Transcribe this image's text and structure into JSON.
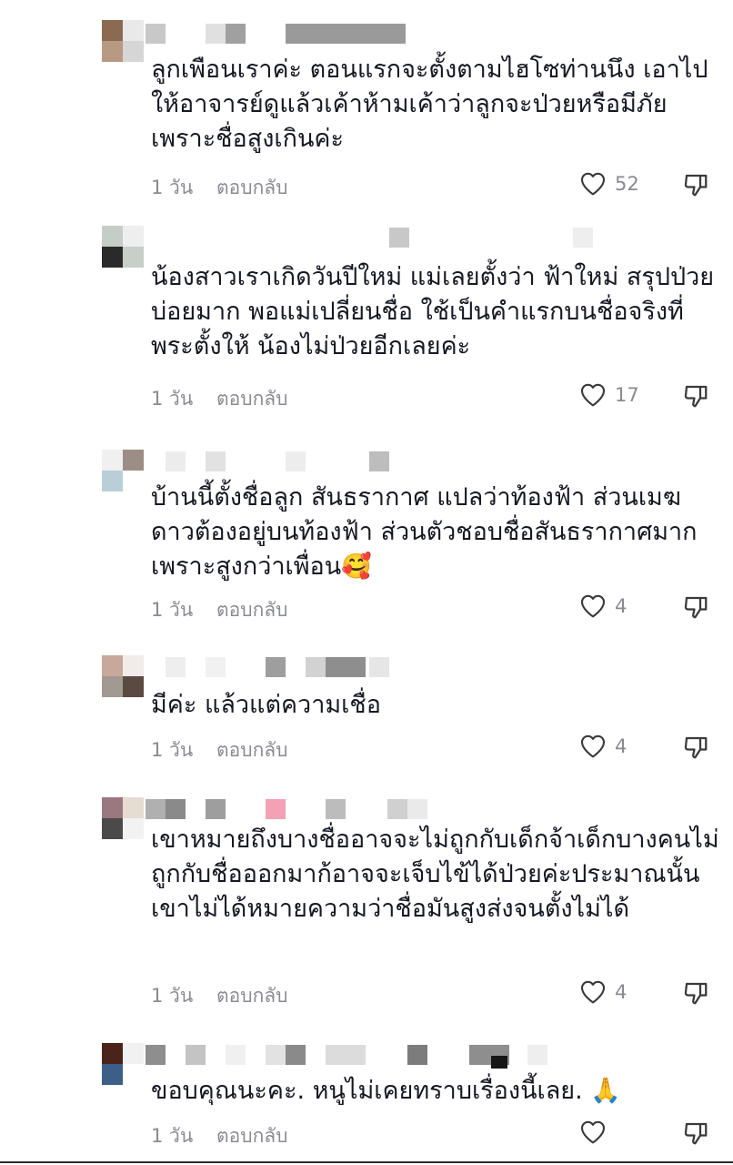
{
  "comments": [
    {
      "text": "ลูกเพือนเราค่ะ ตอนแรกจะตั้งตามไฮโซท่านนึง เอาไปให้อาจารย์ดูแล้วเค้าห้ามเค้าว่าลูกจะป่วยหรือมีภัยเพราะชื่อสูงเกินค่ะ",
      "time": "1 วัน",
      "reply": "ตอบกลับ",
      "likes": "52"
    },
    {
      "text": "น้องสาวเราเกิดวันปีใหม่ แม่เลยตั้งว่า ฟ้าใหม่ สรุปป่วยบ่อยมาก พอแม่เปลี่ยนชื่อ ใช้เป็นคำแรกบนชื่อจริงที่พระตั้งให้ น้องไม่ป่วยอีกเลยค่ะ",
      "time": "1 วัน",
      "reply": "ตอบกลับ",
      "likes": "17"
    },
    {
      "text": "บ้านนี้ตั้งชื่อลูก สันธรากาศ แปลว่าท้องฟ้า ส่วนเมฆดาวต้องอยู่บนท้องฟ้า ส่วนตัวชอบชื่อสันธรากาศมากเพราะสูงกว่าเพื่อน🥰",
      "time": "1 วัน",
      "reply": "ตอบกลับ",
      "likes": "4"
    },
    {
      "text": "มีค่ะ แล้วแต่ความเชื่อ",
      "time": "1 วัน",
      "reply": "ตอบกลับ",
      "likes": "4"
    },
    {
      "text": "เขาหมายถึงบางชื่ออาจจะไม่ถูกกับเด็กจ้าเด็กบางคนไม่ถูกกับชื่อออกมาก้อาจจะเจ็บไข้ได้ป่วยค่ะประมาณนั้น เขาไม่ได้หมายความว่าชื่อมันสูงส่งจนตั้งไม่ได้",
      "time": "1 วัน",
      "reply": "ตอบกลับ",
      "likes": "4"
    },
    {
      "text": "ขอบคุณนะคะ. หนูไม่เคยทราบเรื่องนี้เลย. 🙏",
      "time": "1 วัน",
      "reply": "ตอบกลับ",
      "likes": ""
    }
  ],
  "icons": {
    "like": "heart-outline-icon",
    "dislike": "thumbs-down-outline-icon"
  },
  "colors": {
    "text": "#161823",
    "meta": "#8a8b91",
    "icon": "#3a3a3a"
  }
}
